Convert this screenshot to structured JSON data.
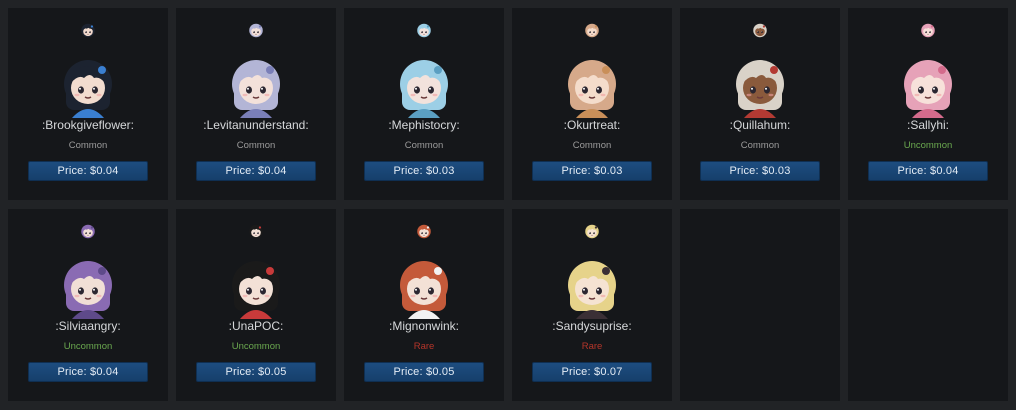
{
  "emotes": [
    {
      "name": ":Brookgiveflower:",
      "rarity": "Common",
      "rarity_color": "#9b9b9b",
      "price": "Price: $0.04",
      "hair": "#1c2330",
      "skin": "#f2dccf",
      "accent": "#3a7fd0"
    },
    {
      "name": ":Levitanunderstand:",
      "rarity": "Common",
      "rarity_color": "#9b9b9b",
      "price": "Price: $0.04",
      "hair": "#b3b5d6",
      "skin": "#f3e1da",
      "accent": "#7a7fb8"
    },
    {
      "name": ":Mephistocry:",
      "rarity": "Common",
      "rarity_color": "#9b9b9b",
      "price": "Price: $0.03",
      "hair": "#9ccfe6",
      "skin": "#f2e2dc",
      "accent": "#5b9fc2"
    },
    {
      "name": ":Okurtreat:",
      "rarity": "Common",
      "rarity_color": "#9b9b9b",
      "price": "Price: $0.03",
      "hair": "#d6a98a",
      "skin": "#f4dccb",
      "accent": "#c98f59"
    },
    {
      "name": ":Quillahum:",
      "rarity": "Common",
      "rarity_color": "#9b9b9b",
      "price": "Price: $0.03",
      "hair": "#d9d2c8",
      "skin": "#8a5a3c",
      "accent": "#b33a33"
    },
    {
      "name": ":Sallyhi:",
      "rarity": "Uncommon",
      "rarity_color": "#6aa84f",
      "price": "Price: $0.04",
      "hair": "#e6a2b8",
      "skin": "#f7e1da",
      "accent": "#d46b8c"
    },
    {
      "name": ":Silviaangry:",
      "rarity": "Uncommon",
      "rarity_color": "#6aa84f",
      "price": "Price: $0.04",
      "hair": "#8a6bb3",
      "skin": "#f1dfd6",
      "accent": "#5e4a8a"
    },
    {
      "name": ":UnaPOC:",
      "rarity": "Uncommon",
      "rarity_color": "#6aa84f",
      "price": "Price: $0.05",
      "hair": "#1a1a1a",
      "skin": "#f3e1d6",
      "accent": "#c83a3a"
    },
    {
      "name": ":Mignonwink:",
      "rarity": "Rare",
      "rarity_color": "#b5352a",
      "price": "Price: $0.05",
      "hair": "#c45a3a",
      "skin": "#f3e1d6",
      "accent": "#f2f2f2"
    },
    {
      "name": ":Sandysuprise:",
      "rarity": "Rare",
      "rarity_color": "#b5352a",
      "price": "Price: $0.07",
      "hair": "#e6d38a",
      "skin": "#f5e3d2",
      "accent": "#3a2f35"
    }
  ],
  "empty_slots": 2
}
